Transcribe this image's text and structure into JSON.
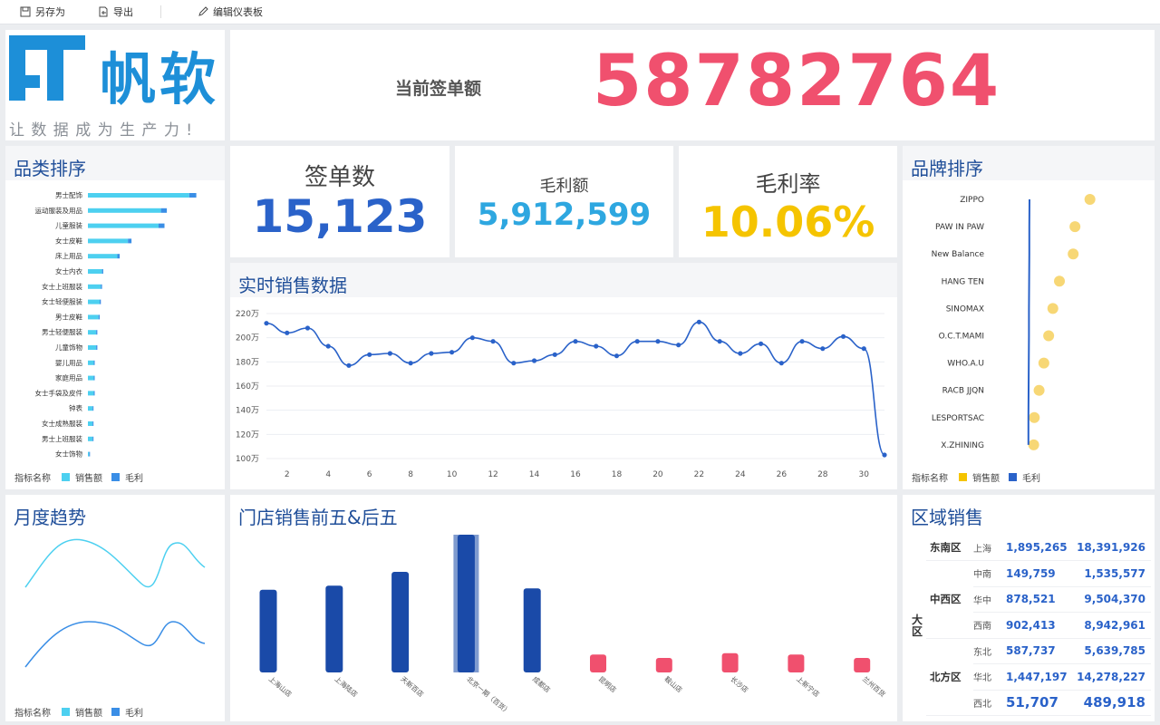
{
  "toolbar": {
    "save_as": "另存为",
    "export": "导出",
    "edit": "编辑仪表板"
  },
  "logo": {
    "name": "帆软",
    "slogan": "让 数 据 成 为 生 产 力 !"
  },
  "headline": {
    "label": "当前签单额",
    "value": "58782764"
  },
  "kpis": {
    "orders": {
      "label": "签单数",
      "value": "15,123",
      "color": "#2a62c9"
    },
    "profit": {
      "label": "毛利额",
      "value": "5,912,599",
      "color": "#2ea7e0"
    },
    "margin": {
      "label": "毛利率",
      "value": "10.06%",
      "color": "#f5c400"
    }
  },
  "category_rank": {
    "title": "品类排序",
    "legend": {
      "prefix": "指标名称",
      "s1": "销售额",
      "s2": "毛利"
    },
    "items": [
      {
        "name": "男士配饰",
        "sales": 0.86,
        "profit": 0.06
      },
      {
        "name": "运动服装及用品",
        "sales": 0.62,
        "profit": 0.05
      },
      {
        "name": "儿童服装",
        "sales": 0.6,
        "profit": 0.05
      },
      {
        "name": "女士皮鞋",
        "sales": 0.34,
        "profit": 0.03
      },
      {
        "name": "床上用品",
        "sales": 0.25,
        "profit": 0.02
      },
      {
        "name": "女士内衣",
        "sales": 0.12,
        "profit": 0.01
      },
      {
        "name": "女士上班服装",
        "sales": 0.11,
        "profit": 0.01
      },
      {
        "name": "女士轻便服装",
        "sales": 0.1,
        "profit": 0.01
      },
      {
        "name": "男士皮鞋",
        "sales": 0.09,
        "profit": 0.01
      },
      {
        "name": "男士轻便服装",
        "sales": 0.07,
        "profit": 0.01
      },
      {
        "name": "儿童饰物",
        "sales": 0.07,
        "profit": 0.01
      },
      {
        "name": "婴儿用品",
        "sales": 0.05,
        "profit": 0.005
      },
      {
        "name": "家庭用品",
        "sales": 0.05,
        "profit": 0.005
      },
      {
        "name": "女士手袋及皮件",
        "sales": 0.05,
        "profit": 0.005
      },
      {
        "name": "钟表",
        "sales": 0.04,
        "profit": 0.005
      },
      {
        "name": "女士成熟服装",
        "sales": 0.04,
        "profit": 0.005
      },
      {
        "name": "男士上班服装",
        "sales": 0.04,
        "profit": 0.005
      },
      {
        "name": "女士饰物",
        "sales": 0.01,
        "profit": 0.002
      }
    ]
  },
  "realtime": {
    "title": "实时销售数据",
    "chart_data": {
      "type": "line",
      "xlabel": "",
      "ylabel": "",
      "ylim": [
        100,
        220
      ],
      "yticks": [
        "100万",
        "120万",
        "140万",
        "160万",
        "180万",
        "200万",
        "220万"
      ],
      "yvals": [
        100,
        120,
        140,
        160,
        180,
        200,
        220
      ],
      "xticks": [
        2,
        4,
        6,
        8,
        10,
        12,
        14,
        16,
        18,
        20,
        22,
        24,
        26,
        28,
        30
      ],
      "x": [
        1,
        2,
        3,
        4,
        5,
        6,
        7,
        8,
        9,
        10,
        11,
        12,
        13,
        14,
        15,
        16,
        17,
        18,
        19,
        20,
        21,
        22,
        23,
        24,
        25,
        26,
        27,
        28,
        29,
        30,
        31
      ],
      "values": [
        212,
        204,
        208,
        193,
        177,
        186,
        187,
        179,
        187,
        188,
        200,
        197,
        179,
        181,
        186,
        197,
        193,
        185,
        197,
        197,
        194,
        213,
        197,
        187,
        195,
        179,
        197,
        191,
        201,
        191,
        103
      ]
    }
  },
  "brand_rank": {
    "title": "品牌排序",
    "legend": {
      "prefix": "指标名称",
      "s1": "销售额",
      "s2": "毛利"
    },
    "chart_data": {
      "type": "scatter",
      "categories": [
        "ZIPPO",
        "PAW IN PAW",
        "New Balance",
        "HANG TEN",
        "SINOMAX",
        "O.C.T.MAMI",
        "WHO.A.U",
        "RACB JJQN",
        "LESPORTSAC",
        "X.ZHINING"
      ],
      "sales": [
        0.98,
        0.73,
        0.7,
        0.47,
        0.36,
        0.29,
        0.21,
        0.13,
        0.05,
        0.04
      ],
      "profit": [
        0.1,
        0.09,
        0.09,
        0.08,
        0.07,
        0.07,
        0.06,
        0.05,
        0.04,
        0.04
      ]
    }
  },
  "monthly": {
    "title": "月度趋势",
    "legend": {
      "prefix": "指标名称",
      "s1": "销售额",
      "s2": "毛利"
    }
  },
  "stores": {
    "title": "门店销售前五&后五",
    "chart_data": {
      "type": "bar",
      "categories": [
        "上海山店",
        "上海陆店",
        "天新百店",
        "北京一期（百货）",
        "成都店",
        "昆明店",
        "鞍山店",
        "长沙店",
        "上新宁店",
        "兰州百货"
      ],
      "values": [
        0.6,
        0.63,
        0.73,
        1.0,
        0.61,
        0.13,
        0.09,
        0.14,
        0.13,
        0.08
      ]
    }
  },
  "region": {
    "title": "区域销售",
    "dim": "大区",
    "groups": [
      {
        "name": "东南区",
        "rows": [
          {
            "city": "上海",
            "a": "1,895,265",
            "b": "18,391,926"
          }
        ]
      },
      {
        "name": "中西区",
        "rows": [
          {
            "city": "中南",
            "a": "149,759",
            "b": "1,535,577"
          },
          {
            "city": "华中",
            "a": "878,521",
            "b": "9,504,370"
          },
          {
            "city": "西南",
            "a": "902,413",
            "b": "8,942,961"
          }
        ]
      },
      {
        "name": "北方区",
        "rows": [
          {
            "city": "东北",
            "a": "587,737",
            "b": "5,639,785"
          },
          {
            "city": "华北",
            "a": "1,447,197",
            "b": "14,278,227"
          },
          {
            "city": "西北",
            "a": "51,707",
            "b": "489,918"
          }
        ]
      }
    ]
  },
  "colors": {
    "sales": "#4dd0f0",
    "profit": "#3a8ee6",
    "line": "#2a62c9",
    "red": "#f0506e",
    "navy": "#1a4aa8",
    "yellow": "#f7d775"
  }
}
